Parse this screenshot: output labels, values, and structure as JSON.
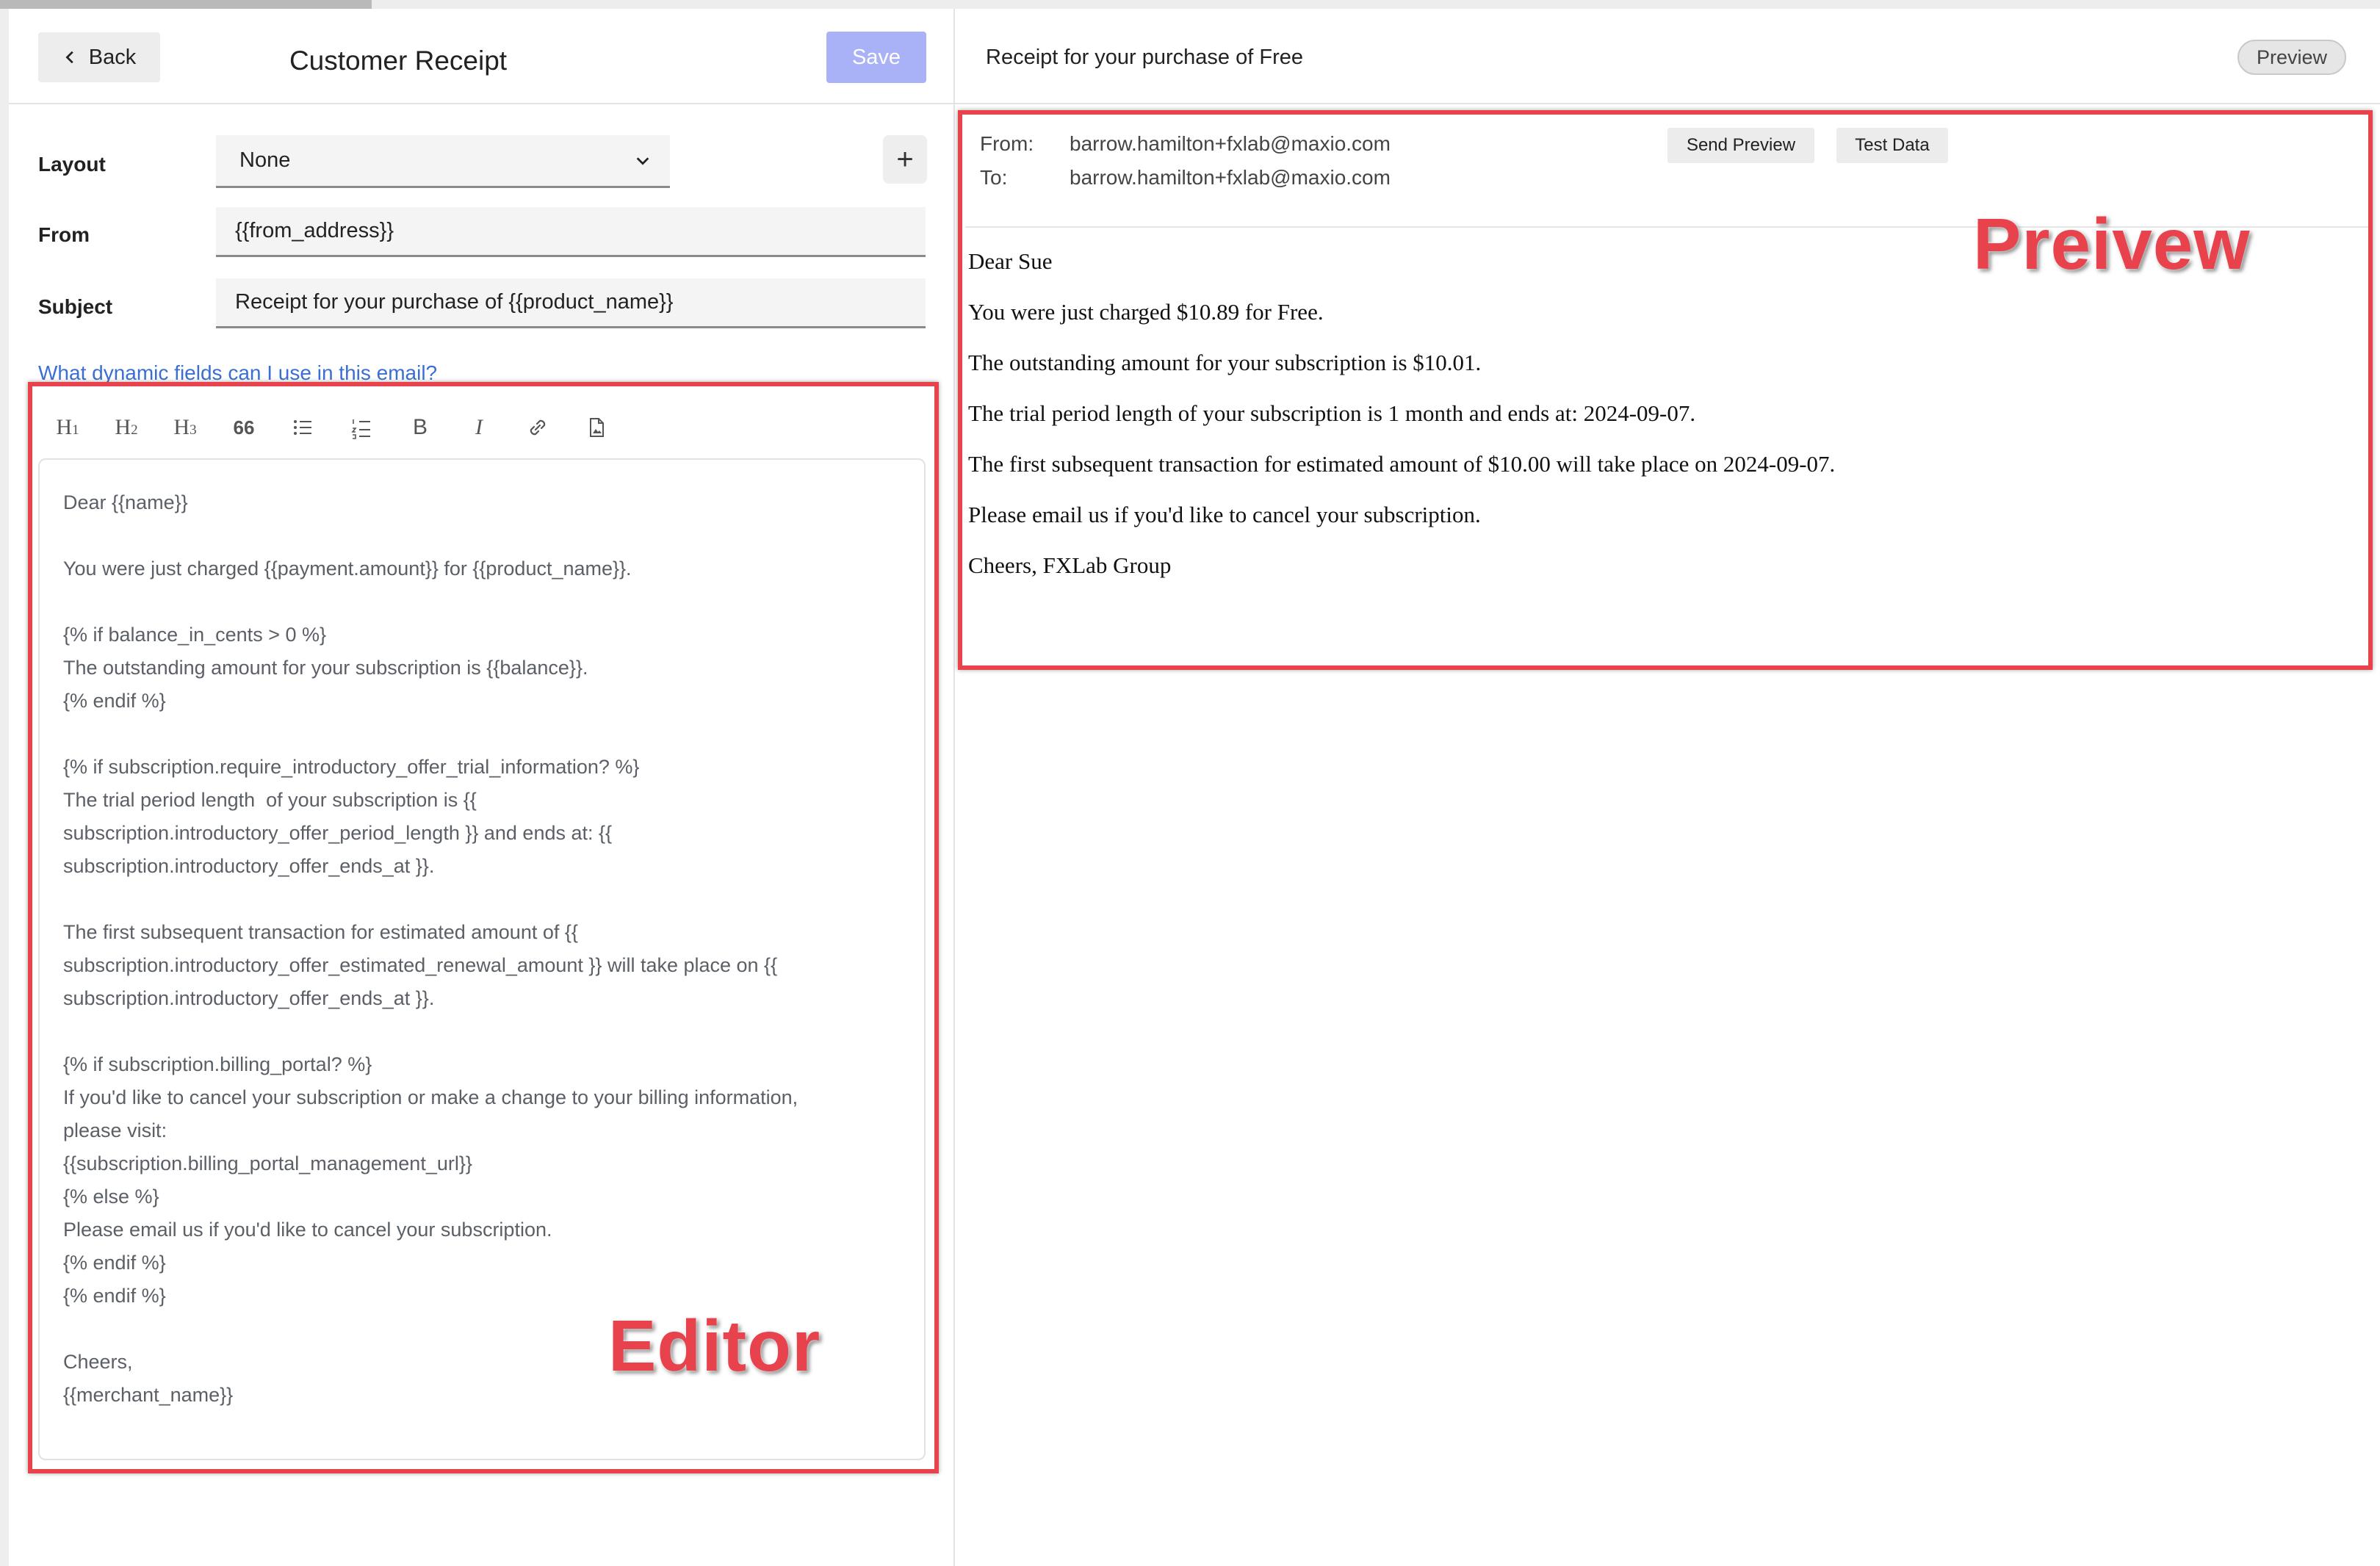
{
  "editor_panel": {
    "back_label": "Back",
    "title": "Customer Receipt",
    "save_label": "Save",
    "layout_label": "Layout",
    "layout_value": "None",
    "add_label": "+",
    "from_label": "From",
    "from_value": "{{from_address}}",
    "subject_label": "Subject",
    "subject_value": "Receipt for your purchase of {{product_name}}",
    "help_link": "What dynamic fields can I use in this email?",
    "toolbar": [
      "H1",
      "H2",
      "H3",
      "66",
      "bulleted-list",
      "numbered-list",
      "B",
      "I",
      "link",
      "image"
    ],
    "editor_lines": [
      "Dear {{name}}",
      "",
      "You were just charged {{payment.amount}} for {{product_name}}.",
      "",
      "{% if balance_in_cents > 0 %}",
      "The outstanding amount for your subscription is {{balance}}.",
      "{% endif %}",
      "",
      "{% if subscription.require_introductory_offer_trial_information? %}",
      "The trial period length  of your subscription is {{",
      "subscription.introductory_offer_period_length }} and ends at: {{",
      "subscription.introductory_offer_ends_at }}.",
      "",
      "The first subsequent transaction for estimated amount of {{",
      "subscription.introductory_offer_estimated_renewal_amount }} will take place on {{",
      "subscription.introductory_offer_ends_at }}.",
      "",
      "{% if subscription.billing_portal? %}",
      "If you'd like to cancel your subscription or make a change to your billing information,",
      "please visit:",
      "{{subscription.billing_portal_management_url}}",
      "{% else %}",
      "Please email us if you'd like to cancel your subscription.",
      "{% endif %}",
      "{% endif %}",
      "",
      "Cheers,",
      "{{merchant_name}}"
    ],
    "overlay_label": "Editor"
  },
  "preview_panel": {
    "title": "Receipt for your purchase of Free",
    "preview_pill": "Preview",
    "from_label": "From:",
    "from_value": "barrow.hamilton+fxlab@maxio.com",
    "to_label": "To:",
    "to_value": "barrow.hamilton+fxlab@maxio.com",
    "send_preview_label": "Send Preview",
    "test_data_label": "Test Data",
    "body_lines": [
      "Dear Sue",
      "You were just charged $10.89 for Free.",
      "The outstanding amount for your subscription is $10.01.",
      "The trial period length of your subscription is 1 month and ends at: 2024-09-07.",
      "The first subsequent transaction for estimated amount of $10.00 will take place on 2024-09-07.",
      "Please email us if you'd like to cancel your subscription.",
      "Cheers, FXLab Group"
    ],
    "overlay_label": "Preivew"
  },
  "colors": {
    "annotation_red": "#e8424d",
    "save_button": "#aab2f7",
    "link_blue": "#3b6fd4"
  }
}
